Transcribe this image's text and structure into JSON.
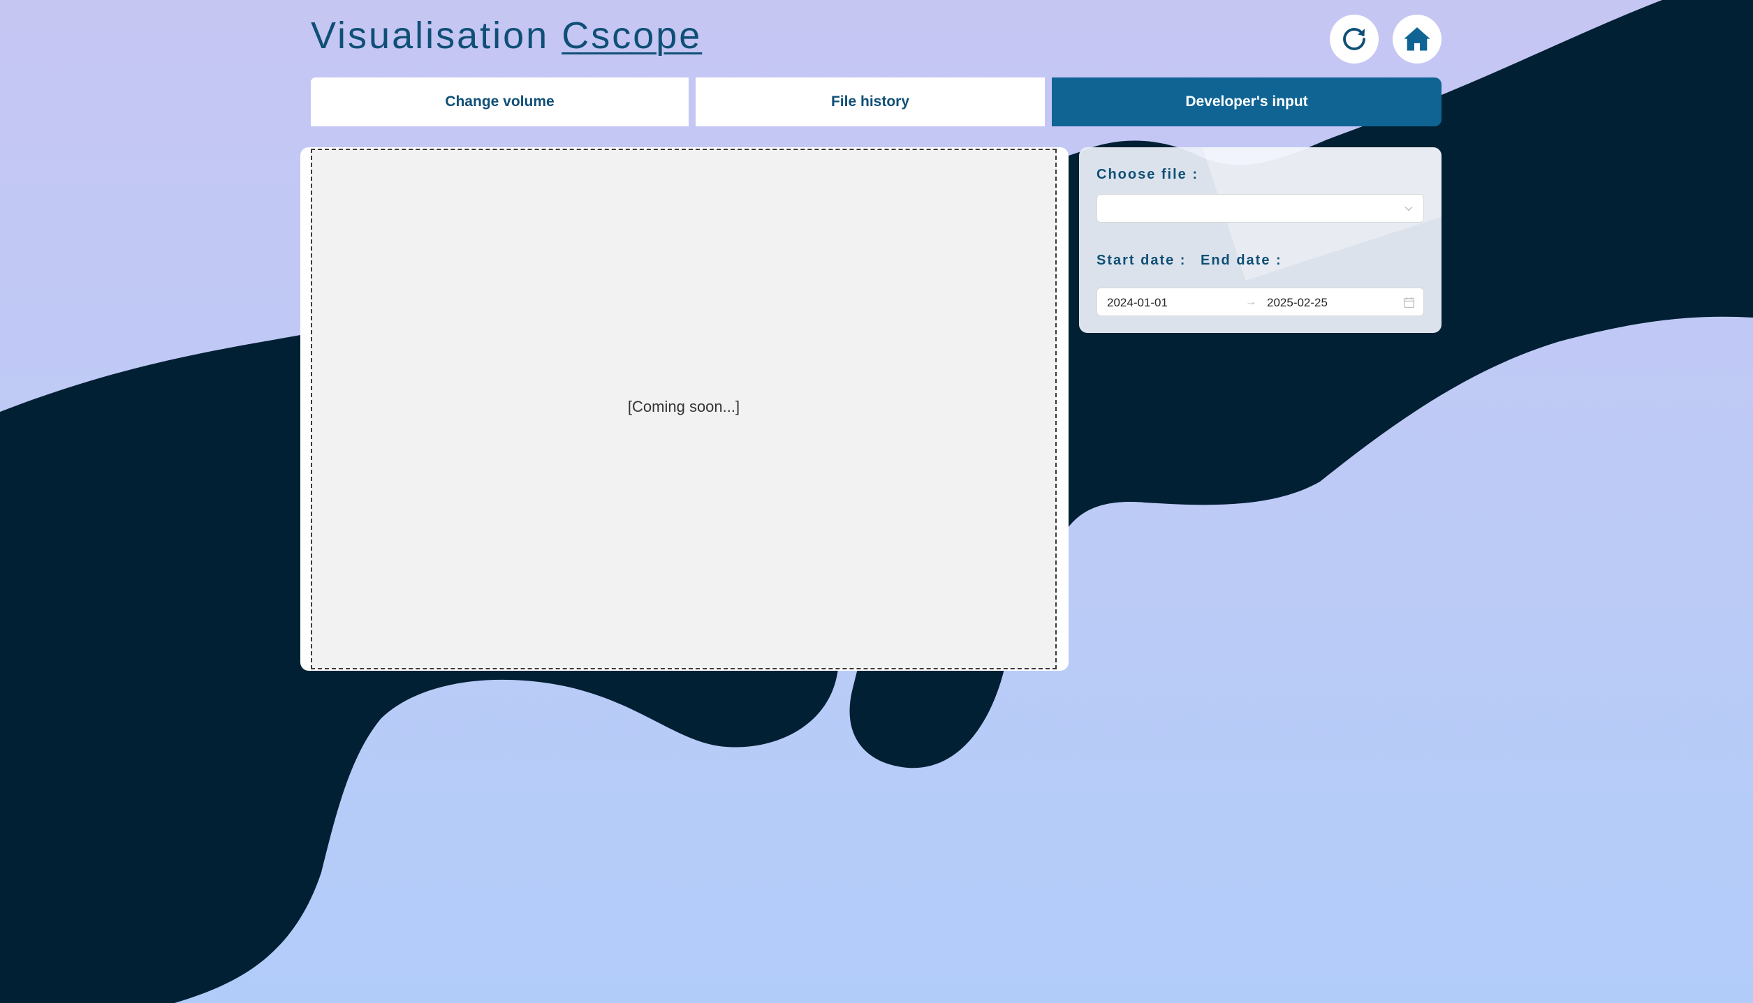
{
  "app": {
    "title_prefix": "Visualisation",
    "title_brand": "Cscope"
  },
  "header": {
    "refresh_icon": "refresh-icon",
    "home_icon": "home-icon"
  },
  "tabs": [
    {
      "label": "Change volume",
      "active": false
    },
    {
      "label": "File history",
      "active": false
    },
    {
      "label": "Developer's input",
      "active": true
    }
  ],
  "main": {
    "placeholder_text": "[Coming soon...]"
  },
  "sidebar": {
    "choose_file_label": "Choose file :",
    "choose_file_value": "",
    "start_date_label": "Start date :",
    "end_date_label": "End date :",
    "start_date": "2024-01-01",
    "end_date": "2025-02-25",
    "range_separator": "→"
  },
  "colors": {
    "accent": "#0f6493",
    "text_primary": "#0f4f76",
    "wave_dark": "#022033",
    "bg_light": "#c6c6f3"
  }
}
